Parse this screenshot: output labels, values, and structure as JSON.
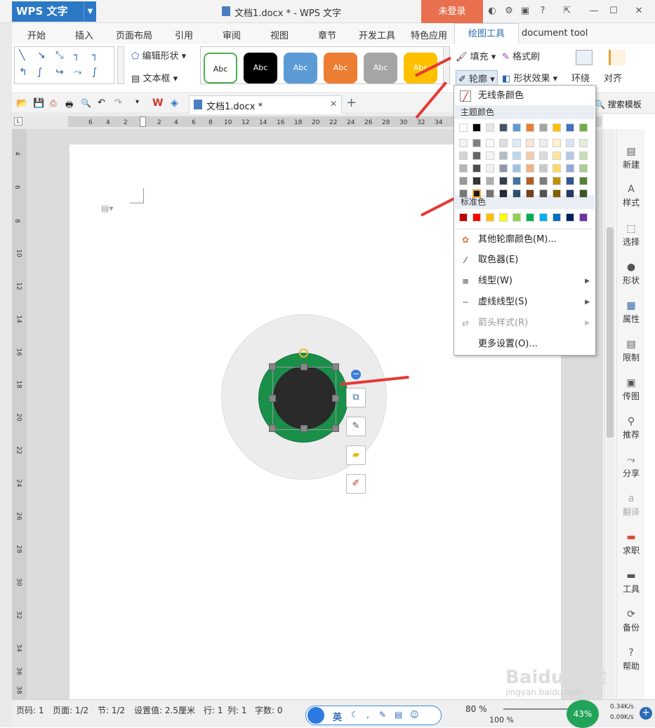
{
  "titlebar": {
    "app_name": "WPS 文字",
    "doc_title": "文档1.docx * - WPS 文字",
    "login_label": "未登录"
  },
  "tabs": [
    "开始",
    "插入",
    "页面布局",
    "引用",
    "审阅",
    "视图",
    "章节",
    "开发工具",
    "特色应用",
    "绘图工具",
    "document tool"
  ],
  "ribbon": {
    "edit_shape": "编辑形状",
    "textbox": "文本框",
    "style_samples": [
      "Abc",
      "Abc",
      "Abc",
      "Abc",
      "Abc",
      "Abc"
    ],
    "fill": "填充",
    "format_painter": "格式刷",
    "outline": "轮廓",
    "shape_effects": "形状效果",
    "wrap": "环绕",
    "align": "对齐"
  },
  "quickbar": {
    "doc_tab": "文档1.docx *",
    "search_template": "搜索模板"
  },
  "ruler": {
    "h_ticks": [
      "6",
      "4",
      "2",
      "2",
      "4",
      "6",
      "8",
      "10",
      "12",
      "14",
      "16",
      "18",
      "20",
      "22",
      "24",
      "26",
      "28",
      "30",
      "32",
      "34"
    ],
    "v_ticks": [
      "4",
      "6",
      "8",
      "10",
      "12",
      "14",
      "16",
      "18",
      "20",
      "22",
      "24",
      "26",
      "28",
      "30",
      "32",
      "34",
      "36",
      "38"
    ]
  },
  "dropdown": {
    "no_line": "无线条颜色",
    "theme_colors_label": "主题颜色",
    "standard_colors_label": "标准色",
    "more_colors": "其他轮廓颜色(M)...",
    "eyedropper": "取色器(E)",
    "line_type": "线型(W)",
    "dash_type": "虚线线型(S)",
    "arrow_style": "箭头样式(R)",
    "more_settings": "更多设置(O)...",
    "theme_row": [
      "#ffffff",
      "#000000",
      "#e7e6e6",
      "#44546a",
      "#5b9bd5",
      "#ed7d31",
      "#a5a5a5",
      "#ffc000",
      "#4472c4",
      "#70ad47"
    ],
    "standard_row": [
      "#c00000",
      "#ff0000",
      "#ffc000",
      "#ffff00",
      "#92d050",
      "#00b050",
      "#00b0f0",
      "#0070c0",
      "#002060",
      "#7030a0"
    ]
  },
  "sidebar": [
    "新建",
    "样式",
    "选择",
    "形状",
    "属性",
    "限制",
    "传图",
    "推荐",
    "分享",
    "翻译",
    "求职",
    "工具",
    "备份",
    "帮助"
  ],
  "status": {
    "page_code": "页码: 1",
    "pages": "页面: 1/2",
    "section": "节: 1/2",
    "setting": "设置值: 2.5厘米",
    "row": "行: 1",
    "col": "列: 1",
    "chars": "字数: 0",
    "zoom": "80 %",
    "zoom2": "100 %",
    "percent": "43%",
    "net_up": "0.34K/s",
    "net_down": "0.09K/s",
    "ime": "英"
  },
  "watermark": "Baidu 经验",
  "watermark_sub": "jingyan.baidu.com"
}
